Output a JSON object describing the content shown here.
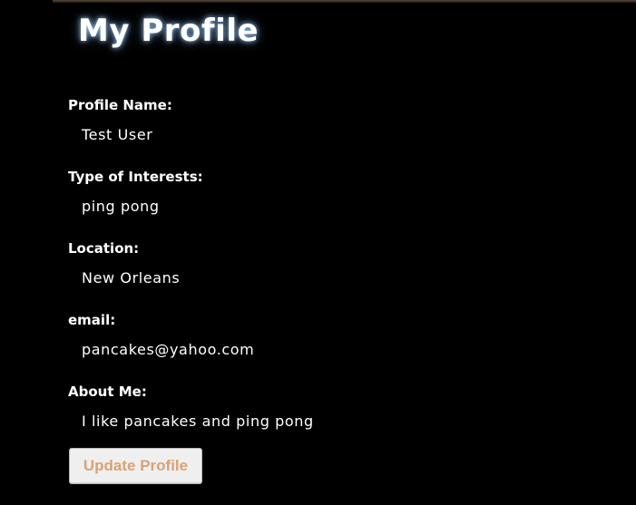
{
  "page": {
    "title": "My Profile"
  },
  "profile": {
    "fields": [
      {
        "label": "Profile Name:",
        "value": "Test User"
      },
      {
        "label": "Type of Interests:",
        "value": "ping pong"
      },
      {
        "label": "Location:",
        "value": "New Orleans"
      },
      {
        "label": "email:",
        "value": "pancakes@yahoo.com"
      },
      {
        "label": "About Me:",
        "value": "I like pancakes and ping pong"
      }
    ]
  },
  "actions": {
    "update_label": "Update Profile"
  },
  "colors": {
    "background": "#000000",
    "text": "#ffffff",
    "title_glow": "#aad2ff",
    "button_text": "#d9a274",
    "button_bg": "#efefef"
  }
}
